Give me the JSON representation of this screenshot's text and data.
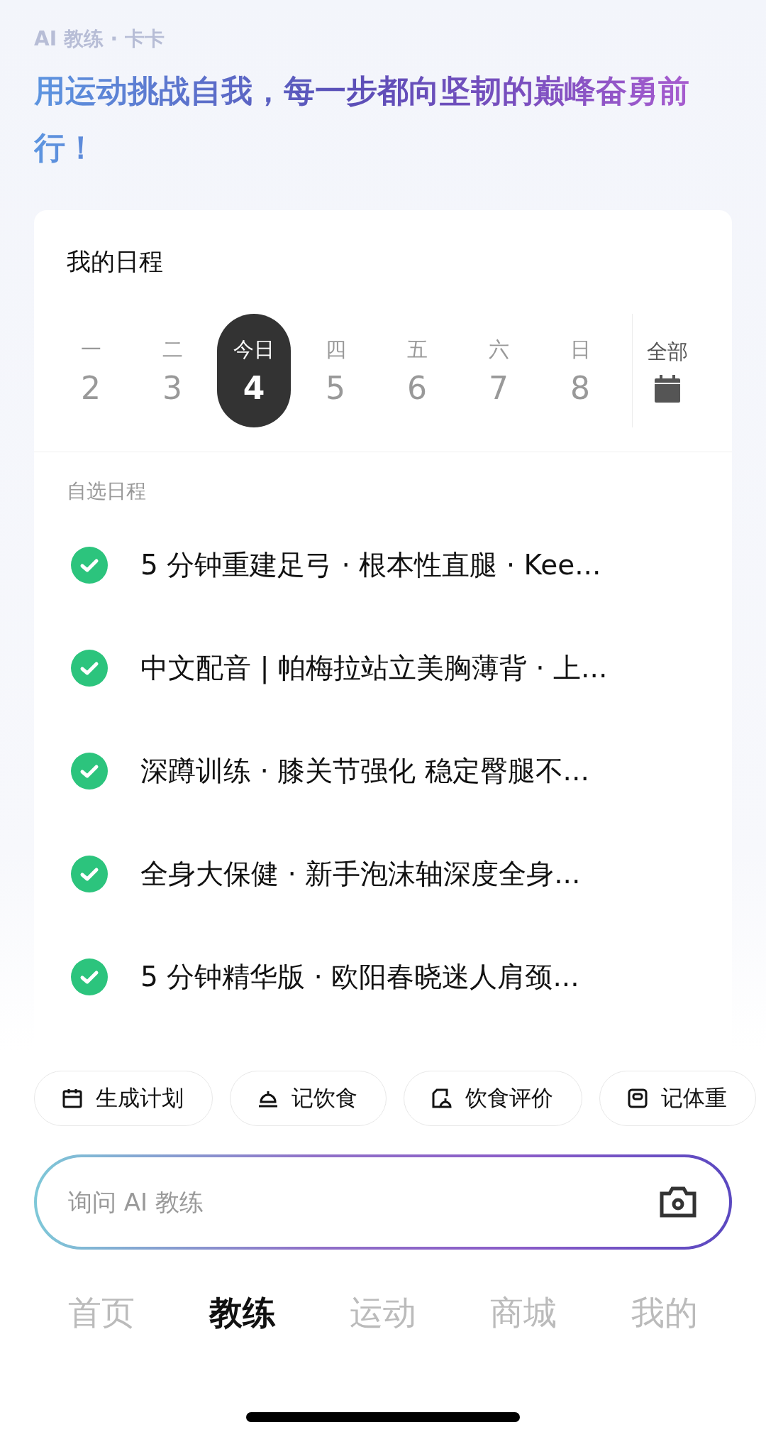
{
  "header": {
    "subtitle": "AI 教练 · 卡卡",
    "slogan": "用运动挑战自我，每一步都向坚韧的巅峰奋勇前行！"
  },
  "schedule": {
    "title": "我的日程",
    "days": [
      {
        "weekday": "一",
        "date": "2",
        "selected": false
      },
      {
        "weekday": "二",
        "date": "3",
        "selected": false
      },
      {
        "weekday": "今日",
        "date": "4",
        "selected": true
      },
      {
        "weekday": "四",
        "date": "5",
        "selected": false
      },
      {
        "weekday": "五",
        "date": "6",
        "selected": false
      },
      {
        "weekday": "六",
        "date": "7",
        "selected": false
      },
      {
        "weekday": "日",
        "date": "8",
        "selected": false
      }
    ],
    "all_label": "全部",
    "section_label": "自选日程",
    "items": [
      {
        "title": "5 分钟重建足弓 · 根本性直腿 · Kee...",
        "done": true
      },
      {
        "title": "中文配音 | 帕梅拉站立美胸薄背 · 上...",
        "done": true
      },
      {
        "title": "深蹲训练 · 膝关节强化 稳定臀腿不...",
        "done": true
      },
      {
        "title": "全身大保健 · 新手泡沫轴深度全身...",
        "done": true
      },
      {
        "title": "5 分钟精华版 · 欧阳春晓迷人肩颈...",
        "done": true
      }
    ]
  },
  "quick_actions": [
    {
      "label": "生成计划",
      "kind": "plan"
    },
    {
      "label": "记饮食",
      "kind": "meal"
    },
    {
      "label": "饮食评价",
      "kind": "review"
    },
    {
      "label": "记体重",
      "kind": "weight"
    }
  ],
  "input": {
    "placeholder": "询问 AI 教练"
  },
  "tabs": [
    {
      "label": "首页",
      "selected": false
    },
    {
      "label": "教练",
      "selected": true
    },
    {
      "label": "运动",
      "selected": false
    },
    {
      "label": "商城",
      "selected": false
    },
    {
      "label": "我的",
      "selected": false
    }
  ]
}
